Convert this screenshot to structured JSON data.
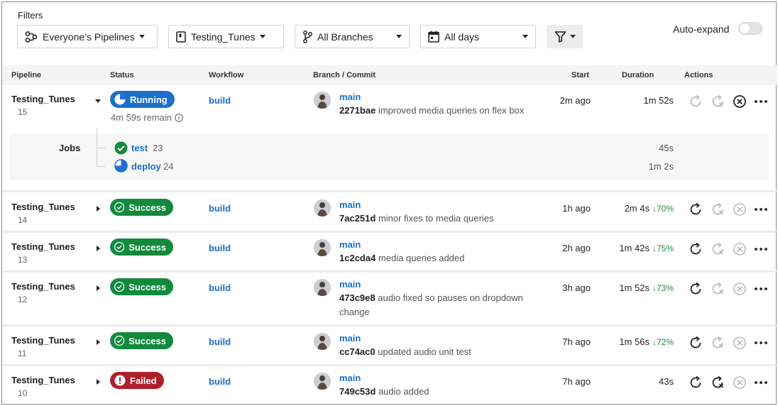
{
  "filters": {
    "label": "Filters",
    "owner": "Everyone’s Pipelines",
    "project": "Testing_Tunes",
    "branch": "All Branches",
    "days": "All days",
    "auto_expand_label": "Auto-expand",
    "auto_expand_on": false
  },
  "columns": {
    "pipeline": "Pipeline",
    "status": "Status",
    "workflow": "Workflow",
    "branch_commit": "Branch / Commit",
    "start": "Start",
    "duration": "Duration",
    "actions": "Actions"
  },
  "pipelines": [
    {
      "name": "Testing_Tunes",
      "number": "15",
      "status": "Running",
      "status_note": "4m 59s remain",
      "workflow": "build",
      "branch": "main",
      "commit_hash": "2271bae",
      "commit_msg": "improved media queries on flex box",
      "commit_msg2": "",
      "start": "2m ago",
      "duration": "1m 52s",
      "change": "",
      "expanded": true
    },
    {
      "name": "Testing_Tunes",
      "number": "14",
      "status": "Success",
      "workflow": "build",
      "branch": "main",
      "commit_hash": "7ac251d",
      "commit_msg": "minor fixes to media queries",
      "commit_msg2": "",
      "start": "1h ago",
      "duration": "2m 4s",
      "change": "70%"
    },
    {
      "name": "Testing_Tunes",
      "number": "13",
      "status": "Success",
      "workflow": "build",
      "branch": "main",
      "commit_hash": "1c2cda4",
      "commit_msg": "media queries added",
      "commit_msg2": "",
      "start": "2h ago",
      "duration": "1m 42s",
      "change": "75%"
    },
    {
      "name": "Testing_Tunes",
      "number": "12",
      "status": "Success",
      "workflow": "build",
      "branch": "main",
      "commit_hash": "473c9e8",
      "commit_msg": "audio fixed so pauses on dropdown",
      "commit_msg2": "change",
      "start": "3h ago",
      "duration": "1m 52s",
      "change": "73%"
    },
    {
      "name": "Testing_Tunes",
      "number": "11",
      "status": "Success",
      "workflow": "build",
      "branch": "main",
      "commit_hash": "cc74ac0",
      "commit_msg": "updated audio unit test",
      "commit_msg2": "",
      "start": "7h ago",
      "duration": "1m 56s",
      "change": "72%"
    },
    {
      "name": "Testing_Tunes",
      "number": "10",
      "status": "Failed",
      "workflow": "build",
      "branch": "main",
      "commit_hash": "749c53d",
      "commit_msg": "audio added",
      "commit_msg2": "",
      "start": "7h ago",
      "duration": "43s",
      "change": ""
    }
  ],
  "jobs": {
    "label": "Jobs",
    "items": [
      {
        "name": "test",
        "number": "23",
        "duration": "45s",
        "state": "success"
      },
      {
        "name": "deploy",
        "number": "24",
        "duration": "1m 2s",
        "state": "running"
      }
    ]
  },
  "colors": {
    "running": "#1e6fcc",
    "success": "#128a3d",
    "failed": "#b0202a",
    "link": "#1a6fc2"
  }
}
